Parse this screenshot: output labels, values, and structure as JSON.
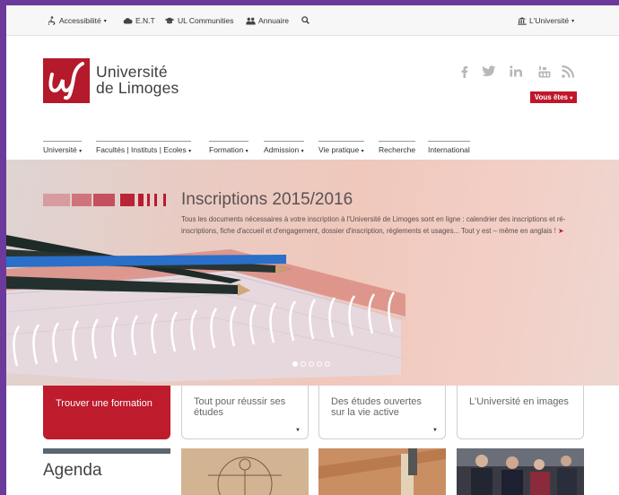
{
  "topbar": {
    "accessibility": "Accessibilité",
    "ent": "E.N.T",
    "communities": "UL Communities",
    "annuaire": "Annuaire",
    "universite": "L'Université"
  },
  "header": {
    "logo_line1": "Université",
    "logo_line2": "de Limoges",
    "vous_etes": "Vous êtes"
  },
  "nav": {
    "items": [
      "Université",
      "Facultés | Instituts | Ecoles",
      "Formation",
      "Admission",
      "Vie pratique",
      "Recherche",
      "International"
    ]
  },
  "hero": {
    "title": "Inscriptions 2015/2016",
    "text": "Tous les documents nécessaires à votre inscription à l'Université de Limoges sont en ligne : calendrier des inscriptions et ré-inscriptions, fiche d'accueil et d'engagement, dossier d'inscription, règlements et usages... Tout y est – même en anglais !",
    "arrow": "➤",
    "slides_total": 5,
    "slide_active": 1
  },
  "cards": {
    "c1": "Trouver une formation",
    "c2": "Tout pour réussir ses études",
    "c3": "Des études ouvertes sur la vie active",
    "c4": "L'Université en images"
  },
  "agenda": {
    "title": "Agenda"
  },
  "colors": {
    "brand": "#be1b2d",
    "background": "#6b3a9a"
  }
}
